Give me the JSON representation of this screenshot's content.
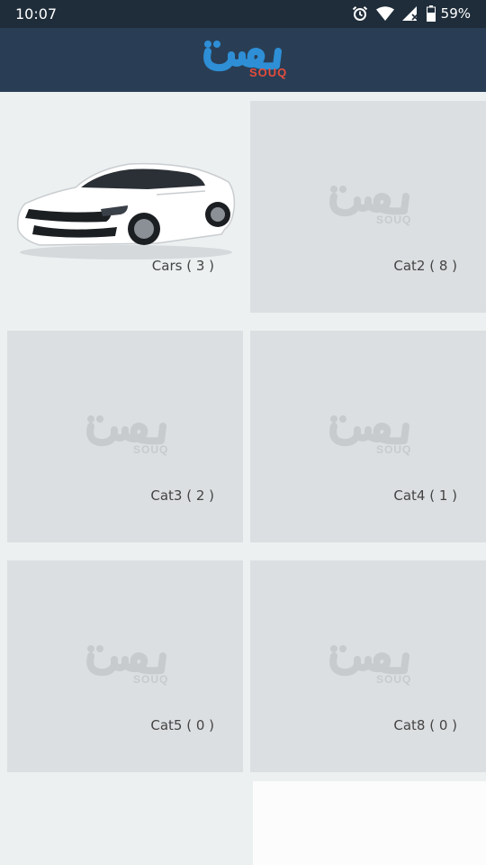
{
  "status_bar": {
    "time": "10:07",
    "battery_percent": "59%",
    "icons": [
      "alarm-icon",
      "wifi-icon",
      "signal-icon",
      "battery-icon"
    ]
  },
  "app_bar": {
    "logo_arabic": "سوق",
    "logo_latin": "SOUQ",
    "colors": {
      "bar": "#293e55",
      "logo_arabic": "#2e8fd6",
      "logo_latin": "#e74c3c"
    }
  },
  "categories": [
    {
      "label": "Cars ( 3 )",
      "image": "car-image"
    },
    {
      "label": "Cat2 ( 8 )",
      "image": "placeholder-logo"
    },
    {
      "label": "Cat3 ( 2 )",
      "image": "placeholder-logo"
    },
    {
      "label": "Cat4 ( 1 )",
      "image": "placeholder-logo"
    },
    {
      "label": "Cat5 ( 0 )",
      "image": "placeholder-logo"
    },
    {
      "label": "Cat8 ( 0 )",
      "image": "placeholder-logo"
    }
  ],
  "placeholder": {
    "arabic": "سوق",
    "latin": "SOUQ"
  }
}
